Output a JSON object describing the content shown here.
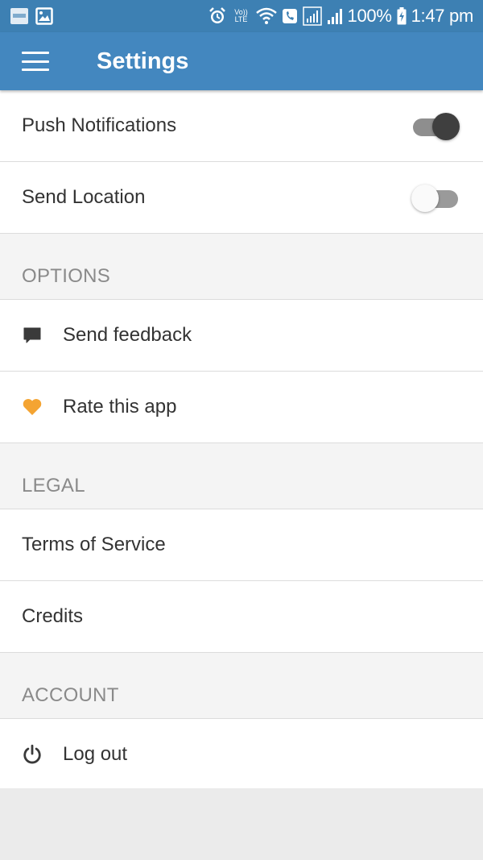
{
  "status_bar": {
    "battery": "100%",
    "time": "1:47 pm",
    "volte_top": "Vo))",
    "volte_bottom": "LTE",
    "icons": [
      "notification-app-icon",
      "gallery-icon",
      "alarm-icon",
      "volte-icon",
      "wifi-icon",
      "call-icon",
      "signal-icon",
      "signal-icon",
      "battery-charging-icon"
    ]
  },
  "app_bar": {
    "title": "Settings",
    "menu_icon": "hamburger-menu-icon"
  },
  "toggles": [
    {
      "label": "Push Notifications",
      "state": "on"
    },
    {
      "label": "Send Location",
      "state": "off"
    }
  ],
  "sections": {
    "options": {
      "header": "OPTIONS",
      "items": [
        {
          "label": "Send feedback",
          "icon": "chat-bubble-icon"
        },
        {
          "label": "Rate this app",
          "icon": "heart-icon"
        }
      ]
    },
    "legal": {
      "header": "LEGAL",
      "items": [
        {
          "label": "Terms of Service"
        },
        {
          "label": "Credits"
        }
      ]
    },
    "account": {
      "header": "ACCOUNT",
      "items": [
        {
          "label": "Log out",
          "icon": "power-icon"
        }
      ]
    }
  },
  "colors": {
    "app_bar": "#4387bf",
    "status_bar": "#3d80b3",
    "heart": "#f4a432",
    "section_header_text": "#8a8a8a"
  }
}
